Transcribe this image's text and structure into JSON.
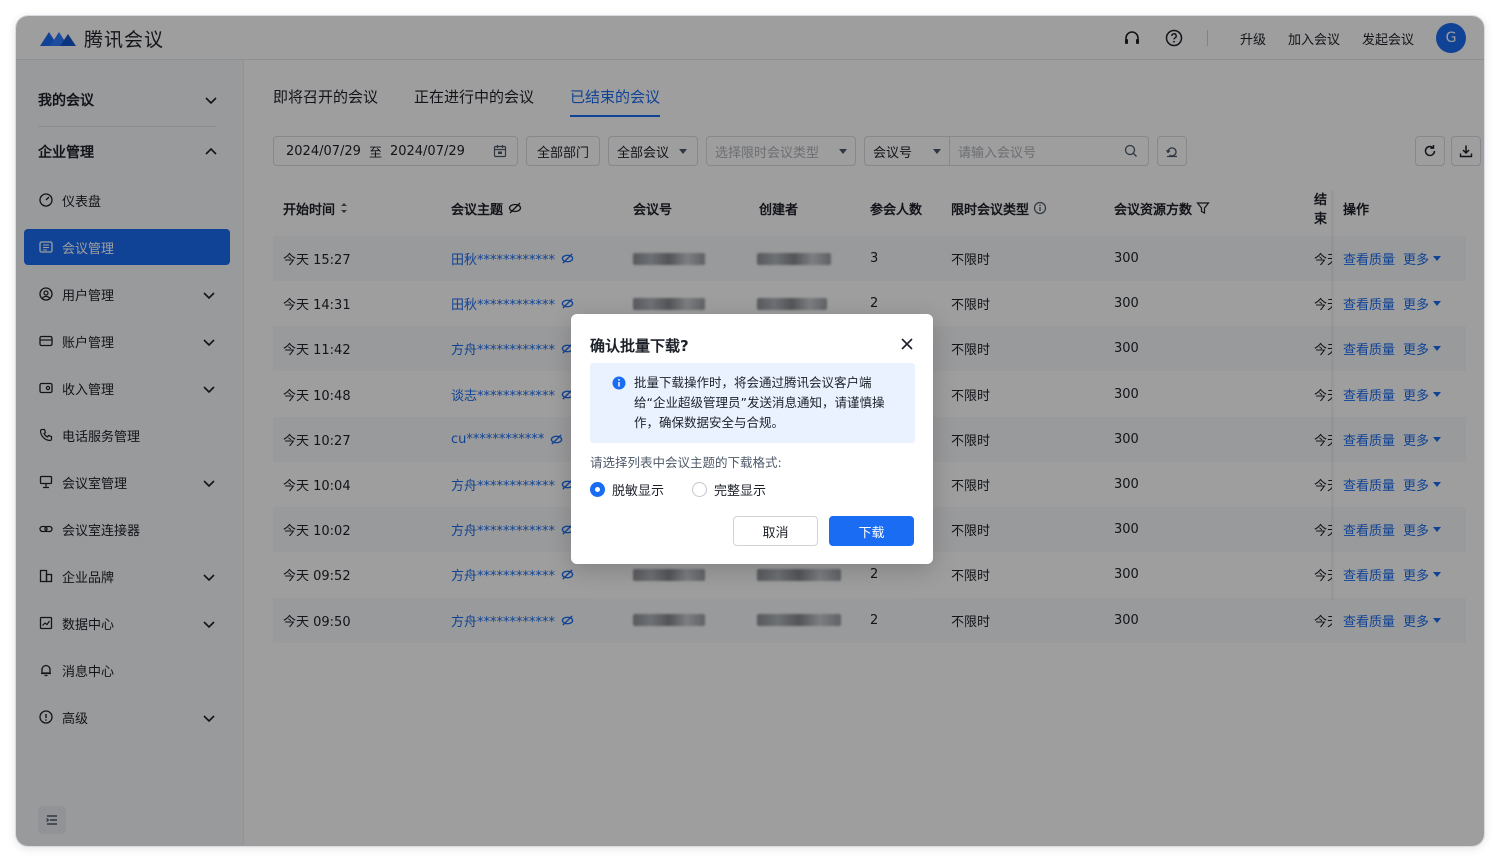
{
  "app": {
    "name": "腾讯会议"
  },
  "header": {
    "upgrade": "升级",
    "join": "加入会议",
    "start": "发起会议",
    "avatar_initial": "G"
  },
  "sidebar": {
    "my_meetings": "我的会议",
    "enterprise": "企业管理",
    "items": [
      {
        "label": "仪表盘",
        "icon": "dashboard-icon",
        "chevron": false
      },
      {
        "label": "会议管理",
        "icon": "list-icon",
        "chevron": false,
        "active": true
      },
      {
        "label": "用户管理",
        "icon": "user-circle-icon",
        "chevron": true
      },
      {
        "label": "账户管理",
        "icon": "wallet-icon",
        "chevron": true
      },
      {
        "label": "收入管理",
        "icon": "income-icon",
        "chevron": true
      },
      {
        "label": "电话服务管理",
        "icon": "phone-icon",
        "chevron": false
      },
      {
        "label": "会议室管理",
        "icon": "room-icon",
        "chevron": true
      },
      {
        "label": "会议室连接器",
        "icon": "link-icon",
        "chevron": false
      },
      {
        "label": "企业品牌",
        "icon": "building-icon",
        "chevron": true
      },
      {
        "label": "数据中心",
        "icon": "chart-icon",
        "chevron": true
      },
      {
        "label": "消息中心",
        "icon": "bell-icon",
        "chevron": false
      },
      {
        "label": "高级",
        "icon": "shield-icon",
        "chevron": true
      }
    ]
  },
  "tabs": [
    "即将召开的会议",
    "正在进行中的会议",
    "已结束的会议"
  ],
  "filters": {
    "date_start": "2024/07/29",
    "date_sep": "至",
    "date_end": "2024/07/29",
    "department": "全部部门",
    "meeting_scope": "全部会议",
    "limit_type_placeholder": "选择限时会议类型",
    "search_field": "会议号",
    "search_placeholder": "请输入会议号"
  },
  "table": {
    "headers": [
      "开始时间",
      "会议主题",
      "会议号",
      "创建者",
      "参会人数",
      "限时会议类型",
      "会议资源方数",
      "结束",
      "操作"
    ],
    "rows": [
      {
        "start": "今天  15:27",
        "topic": "田秋************",
        "participants": "3",
        "limit_type": "不限时",
        "resources": "300",
        "end": "今天"
      },
      {
        "start": "今天  14:31",
        "topic": "田秋************",
        "participants": "2",
        "limit_type": "不限时",
        "resources": "300",
        "end": "今天"
      },
      {
        "start": "今天  11:42",
        "topic": "方舟************",
        "participants": "",
        "limit_type": "不限时",
        "resources": "300",
        "end": "今天"
      },
      {
        "start": "今天  10:48",
        "topic": "谈志************",
        "participants": "",
        "limit_type": "不限时",
        "resources": "300",
        "end": "今天"
      },
      {
        "start": "今天  10:27",
        "topic": "cu************",
        "participants": "",
        "limit_type": "不限时",
        "resources": "300",
        "end": "今天"
      },
      {
        "start": "今天  10:04",
        "topic": "方舟************",
        "participants": "",
        "limit_type": "不限时",
        "resources": "300",
        "end": "今天"
      },
      {
        "start": "今天  10:02",
        "topic": "方舟************",
        "participants": "",
        "limit_type": "不限时",
        "resources": "300",
        "end": "今天"
      },
      {
        "start": "今天  09:52",
        "topic": "方舟************",
        "participants": "2",
        "limit_type": "不限时",
        "resources": "300",
        "end": "今天"
      },
      {
        "start": "今天  09:50",
        "topic": "方舟************",
        "participants": "2",
        "limit_type": "不限时",
        "resources": "300",
        "end": "今天"
      }
    ],
    "op_quality": "查看质量",
    "op_more": "更多"
  },
  "dialog": {
    "title": "确认批量下载?",
    "info": "批量下载操作时，将会通过腾讯会议客户端给“企业超级管理员”发送消息通知，请谨慎操作，确保数据安全与合规。",
    "prompt": "请选择列表中会议主题的下载格式:",
    "option_masked": "脱敏显示",
    "option_full": "完整显示",
    "selected": "脱敏显示",
    "cancel": "取消",
    "confirm": "下载"
  },
  "colors": {
    "accent": "#1a6cf2",
    "overlay": "rgba(0,0,0,0.38)"
  }
}
